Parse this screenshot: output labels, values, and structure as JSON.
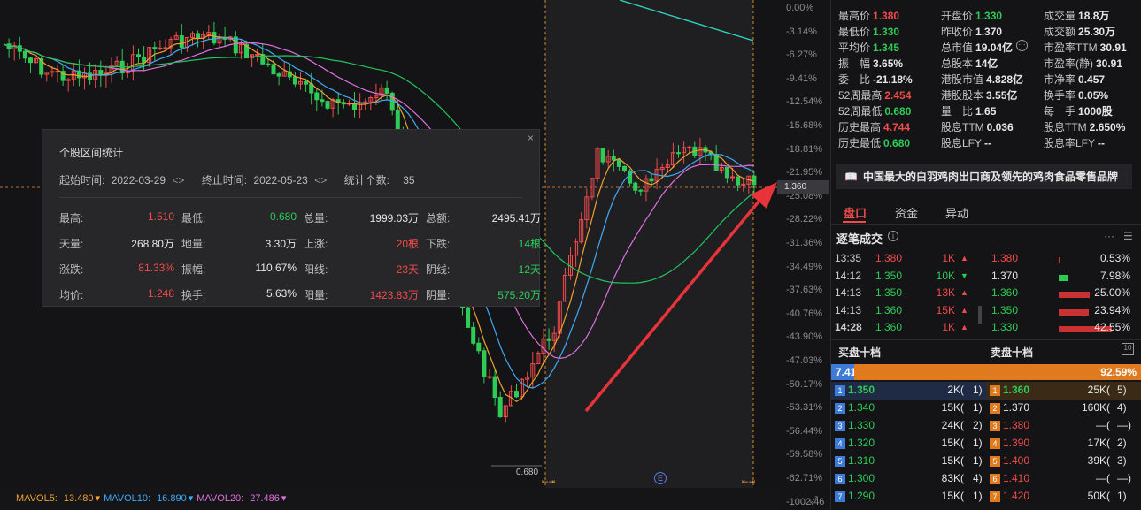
{
  "chart": {
    "y_ticks": [
      "0.00%",
      "-3.14%",
      "-6.27%",
      "-9.41%",
      "-12.54%",
      "-15.68%",
      "-18.81%",
      "-21.95%",
      "-25.08%",
      "-28.22%",
      "-31.36%",
      "-34.49%",
      "-37.63%",
      "-40.76%",
      "-43.90%",
      "-47.03%",
      "-50.17%",
      "-53.31%",
      "-56.44%",
      "-59.58%",
      "-62.71%",
      "-1002.46"
    ],
    "current_price_tag": "1.360",
    "low_label": "0.680",
    "e_marker": "E",
    "gap_marker": "⇤⇥",
    "resize_glyph": "⤢"
  },
  "mavol": [
    {
      "label": "MAVOL5:",
      "value": "13.480",
      "color": "#f0a030"
    },
    {
      "label": "MAVOL10:",
      "value": "16.890",
      "color": "#3fa9f5"
    },
    {
      "label": "MAVOL20:",
      "value": "27.486",
      "color": "#e070e0"
    }
  ],
  "popup": {
    "title": "个股区间统计",
    "close": "×",
    "start_label": "起始时间:",
    "start_value": "2022-03-29",
    "end_label": "终止时间:",
    "end_value": "2022-05-23",
    "count_label": "统计个数:",
    "count_value": "35",
    "arrows": "<>",
    "rows": [
      [
        {
          "l": "最高:",
          "v": "1.510",
          "c": "red"
        },
        {
          "l": "最低:",
          "v": "0.680",
          "c": "green"
        },
        {
          "l": "总量:",
          "v": "1999.03万",
          "c": "white"
        },
        {
          "l": "总额:",
          "v": "2495.41万",
          "c": "white"
        }
      ],
      [
        {
          "l": "天量:",
          "v": "268.80万",
          "c": "white"
        },
        {
          "l": "地量:",
          "v": "3.30万",
          "c": "white"
        },
        {
          "l": "上涨:",
          "v": "20根",
          "c": "red"
        },
        {
          "l": "下跌:",
          "v": "14根",
          "c": "green"
        }
      ],
      [
        {
          "l": "涨跌:",
          "v": "81.33%",
          "c": "red"
        },
        {
          "l": "振幅:",
          "v": "110.67%",
          "c": "white"
        },
        {
          "l": "阳线:",
          "v": "23天",
          "c": "red"
        },
        {
          "l": "阴线:",
          "v": "12天",
          "c": "green"
        }
      ],
      [
        {
          "l": "均价:",
          "v": "1.248",
          "c": "red"
        },
        {
          "l": "换手:",
          "v": "5.63%",
          "c": "white"
        },
        {
          "l": "阳量:",
          "v": "1423.83万",
          "c": "red"
        },
        {
          "l": "阴量:",
          "v": "575.20万",
          "c": "green"
        }
      ]
    ]
  },
  "quote": [
    [
      {
        "l": "最高价",
        "v": "1.380",
        "c": "red"
      },
      {
        "l": "开盘价",
        "v": "1.330",
        "c": "green"
      },
      {
        "l": "成交量",
        "v": "18.8万",
        "c": "white"
      }
    ],
    [
      {
        "l": "最低价",
        "v": "1.330",
        "c": "green"
      },
      {
        "l": "昨收价",
        "v": "1.370",
        "c": "white"
      },
      {
        "l": "成交额",
        "v": "25.30万",
        "c": "white"
      }
    ],
    [
      {
        "l": "平均价",
        "v": "1.345",
        "c": "green"
      },
      {
        "l": "总市值",
        "v": "19.04亿",
        "c": "white"
      },
      {
        "l": "市盈率TTM",
        "v": "30.91",
        "c": "white"
      }
    ],
    [
      {
        "l": "振　幅",
        "v": "3.65%",
        "c": "white"
      },
      {
        "l": "总股本",
        "v": "14亿",
        "c": "white"
      },
      {
        "l": "市盈率(静)",
        "v": "30.91",
        "c": "white"
      }
    ],
    [
      {
        "l": "委　比",
        "v": "-21.18%",
        "c": "white"
      },
      {
        "l": "港股市值",
        "v": "4.828亿",
        "c": "white"
      },
      {
        "l": "市净率",
        "v": "0.457",
        "c": "white"
      }
    ],
    [
      {
        "l": "52周最高",
        "v": "2.454",
        "c": "red"
      },
      {
        "l": "港股股本",
        "v": "3.55亿",
        "c": "white"
      },
      {
        "l": "换手率",
        "v": "0.05%",
        "c": "white"
      }
    ],
    [
      {
        "l": "52周最低",
        "v": "0.680",
        "c": "green"
      },
      {
        "l": "量　比",
        "v": "1.65",
        "c": "white"
      },
      {
        "l": "每　手",
        "v": "1000股",
        "c": "white"
      }
    ],
    [
      {
        "l": "历史最高",
        "v": "4.744",
        "c": "red"
      },
      {
        "l": "股息TTM",
        "v": "0.036",
        "c": "white"
      },
      {
        "l": "股息TTM",
        "v": "2.650%",
        "c": "white"
      }
    ],
    [
      {
        "l": "历史最低",
        "v": "0.680",
        "c": "green"
      },
      {
        "l": "股息LFY",
        "v": "--",
        "c": "white"
      },
      {
        "l": "股息率LFY",
        "v": "--",
        "c": "white"
      }
    ]
  ],
  "more_icon": "···",
  "banner": {
    "icon": "📖",
    "text": "中国最大的白羽鸡肉出口商及领先的鸡肉食品零售品牌"
  },
  "tabs": [
    "盘口",
    "资金",
    "异动"
  ],
  "ticks": {
    "title": "逐笔成交",
    "info": "i",
    "icon_more": "···",
    "icon_list": "☰",
    "rows": [
      {
        "time": "13:35",
        "price": "1.380",
        "pc": "red",
        "vol": "1K",
        "arrow": "▲",
        "ac": "red"
      },
      {
        "time": "14:12",
        "price": "1.350",
        "pc": "green",
        "vol": "10K",
        "arrow": "▼",
        "ac": "green"
      },
      {
        "time": "14:13",
        "price": "1.350",
        "pc": "green",
        "vol": "13K",
        "arrow": "▲",
        "ac": "red"
      },
      {
        "time": "14:13",
        "price": "1.360",
        "pc": "green",
        "vol": "15K",
        "arrow": "▲",
        "ac": "red"
      },
      {
        "time": "14:28",
        "price": "1.360",
        "pc": "green",
        "vol": "1K",
        "arrow": "▲",
        "ac": "red"
      }
    ],
    "dist": [
      {
        "price": "1.380",
        "pc": "red",
        "pct": "0.53%",
        "fill": 0.53,
        "color": "#c93232"
      },
      {
        "price": "1.370",
        "pc": "white",
        "pct": "7.98%",
        "fill": 7.98,
        "color": "#2ecb57"
      },
      {
        "price": "1.360",
        "pc": "green",
        "pct": "25.00%",
        "fill": 25.0,
        "color": "#c93232"
      },
      {
        "price": "1.350",
        "pc": "green",
        "pct": "23.94%",
        "fill": 23.94,
        "color": "#c93232"
      },
      {
        "price": "1.330",
        "pc": "green",
        "pct": "42.55%",
        "fill": 42.55,
        "color": "#c93232"
      }
    ]
  },
  "book": {
    "buy_title": "买盘十档",
    "sell_title": "卖盘十档",
    "icon": "10",
    "buy_ratio": "7.41%",
    "sell_ratio": "92.59%",
    "buy_fraction": 0.0741,
    "rows": [
      {
        "n": "1",
        "bp": "1.350",
        "bv": "2K(",
        "bc": "1)",
        "sp": "1.360",
        "sv": "25K(",
        "sc": "5)",
        "bpc": "green",
        "spc": "green"
      },
      {
        "n": "2",
        "bp": "1.340",
        "bv": "15K(",
        "bc": "1)",
        "sp": "1.370",
        "sv": "160K(",
        "sc": "4)",
        "bpc": "green",
        "spc": "white"
      },
      {
        "n": "3",
        "bp": "1.330",
        "bv": "24K(",
        "bc": "2)",
        "sp": "1.380",
        "sv": "—(",
        "sc": "—)",
        "bpc": "green",
        "spc": "red"
      },
      {
        "n": "4",
        "bp": "1.320",
        "bv": "15K(",
        "bc": "1)",
        "sp": "1.390",
        "sv": "17K(",
        "sc": "2)",
        "bpc": "green",
        "spc": "red"
      },
      {
        "n": "5",
        "bp": "1.310",
        "bv": "15K(",
        "bc": "1)",
        "sp": "1.400",
        "sv": "39K(",
        "sc": "3)",
        "bpc": "green",
        "spc": "red"
      },
      {
        "n": "6",
        "bp": "1.300",
        "bv": "83K(",
        "bc": "4)",
        "sp": "1.410",
        "sv": "—(",
        "sc": "—)",
        "bpc": "green",
        "spc": "red"
      },
      {
        "n": "7",
        "bp": "1.290",
        "bv": "15K(",
        "bc": "1)",
        "sp": "1.420",
        "sv": "50K(",
        "sc": "1)",
        "bpc": "green",
        "spc": "red"
      }
    ]
  },
  "colors": {
    "up": "#f04a4a",
    "down": "#2ecb57",
    "ma5": "#f0a030",
    "ma10": "#3fa9f5",
    "ma20": "#e070e0",
    "ma60": "#22c55e",
    "ma120": "#2dd4bf"
  }
}
